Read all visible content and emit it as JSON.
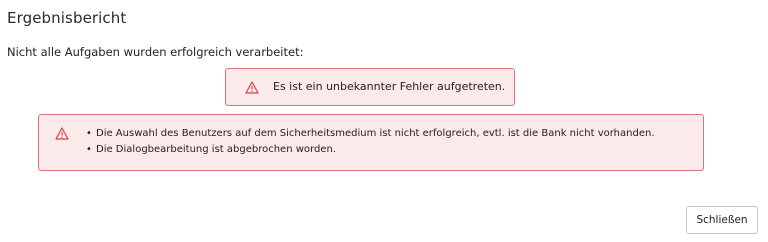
{
  "dialog": {
    "title": "Ergebnisbericht",
    "subtitle": "Nicht alle Aufgaben wurden erfolgreich verarbeitet:",
    "main_error": {
      "icon": "warning-icon",
      "message": "Es ist ein unbekannter Fehler aufgetreten."
    },
    "detail_error": {
      "icon": "warning-icon",
      "bullet": "•",
      "items": [
        "Die Auswahl des Benutzers auf dem Sicherheitsmedium ist nicht erfolgreich, evtl. ist die Bank nicht vorhanden.",
        "Die Dialogbearbeitung ist abgebrochen worden."
      ]
    },
    "close_label": "Schließen"
  },
  "colors": {
    "error_border": "#d9737a",
    "error_background": "#fbeaea",
    "warning_icon": "#d0454c"
  }
}
